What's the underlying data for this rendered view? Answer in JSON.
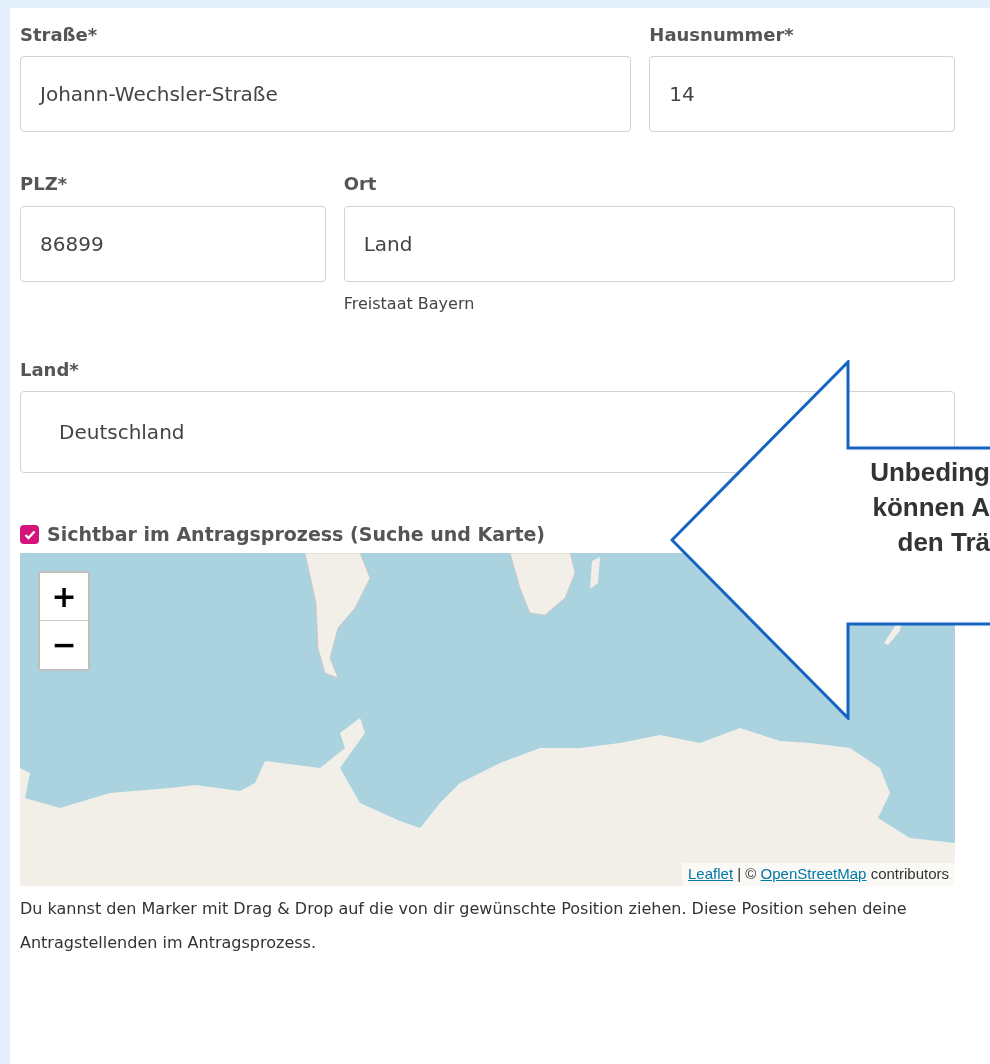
{
  "address_rows": [
    [
      {
        "label": "Straße*",
        "value": "Johann-Wechsler-Straße"
      },
      {
        "label": "Hausnummer*",
        "value": "14"
      }
    ],
    [
      {
        "label": "PLZ*",
        "value": "86899"
      },
      {
        "label": "Ort",
        "value": "Land",
        "hint": "Freistaat Bayern"
      }
    ]
  ],
  "country": {
    "label": "Land*",
    "value": "Deutschland"
  },
  "visibility": {
    "label": "Sichtbar im Antragsprozess (Suche und Karte)",
    "checked": true
  },
  "map": {
    "zoom_in": "+",
    "zoom_out": "−",
    "attribution": {
      "link_1": "Leaflet",
      "separator": "| ©",
      "link_2": "OpenStreetMap",
      "suffix": "contributors"
    }
  },
  "help_text": "Du kannst den Marker mit Drag & Drop auf die von dir gewünschte Position ziehen. Diese Position sehen deine Antragstellenden im Antragsprozess.",
  "callout": {
    "lines": [
      "Unbeding",
      "können A",
      "den Trä"
    ]
  }
}
